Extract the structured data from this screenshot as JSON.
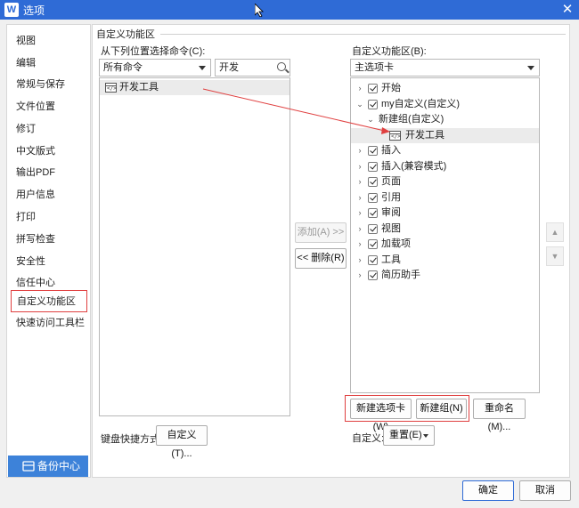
{
  "window": {
    "app_icon": "W",
    "title": "选项",
    "close_glyph": "✕"
  },
  "nav": {
    "items": [
      "视图",
      "编辑",
      "常规与保存",
      "文件位置",
      "修订",
      "中文版式",
      "输出PDF",
      "用户信息",
      "打印",
      "拼写检查",
      "安全性",
      "信任中心",
      "自定义功能区",
      "快速访问工具栏"
    ],
    "active_index": 12,
    "backup_label": "备份中心"
  },
  "main": {
    "section_title": "自定义功能区",
    "left": {
      "choose_label": "从下列位置选择命令(C):",
      "source_select": "所有命令",
      "search_value": "开发",
      "commands": [
        "开发工具"
      ]
    },
    "right": {
      "customize_label": "自定义功能区(B):",
      "tab_select": "主选项卡",
      "tree": [
        {
          "label": "开始",
          "level": 0,
          "expander": "›",
          "checkbox": true,
          "icon": false
        },
        {
          "label": "my自定义(自定义)",
          "level": 0,
          "expander": "⌄",
          "checkbox": true,
          "icon": false
        },
        {
          "label": "新建组(自定义)",
          "level": 1,
          "expander": "⌄",
          "checkbox": false,
          "icon": false
        },
        {
          "label": "开发工具",
          "level": 2,
          "expander": "",
          "checkbox": false,
          "icon": true,
          "selected": true
        },
        {
          "label": "插入",
          "level": 0,
          "expander": "›",
          "checkbox": true,
          "icon": false
        },
        {
          "label": "插入(兼容模式)",
          "level": 0,
          "expander": "›",
          "checkbox": true,
          "icon": false
        },
        {
          "label": "页面",
          "level": 0,
          "expander": "›",
          "checkbox": true,
          "icon": false
        },
        {
          "label": "引用",
          "level": 0,
          "expander": "›",
          "checkbox": true,
          "icon": false
        },
        {
          "label": "审阅",
          "level": 0,
          "expander": "›",
          "checkbox": true,
          "icon": false
        },
        {
          "label": "视图",
          "level": 0,
          "expander": "›",
          "checkbox": true,
          "icon": false
        },
        {
          "label": "加载项",
          "level": 0,
          "expander": "›",
          "checkbox": true,
          "icon": false
        },
        {
          "label": "工具",
          "level": 0,
          "expander": "›",
          "checkbox": true,
          "icon": false
        },
        {
          "label": "简历助手",
          "level": 0,
          "expander": "›",
          "checkbox": true,
          "icon": false
        }
      ],
      "new_tab_button": "新建选项卡(W)",
      "new_group_button": "新建组(N)",
      "rename_button": "重命名(M)...",
      "customize_label2": "自定义:",
      "reset_button": "重置(E)"
    },
    "add_button": "添加(A) >>",
    "remove_button": "<< 删除(R)",
    "move_up": "▲",
    "move_down": "▼",
    "keyboard_label": "键盘快捷方式:",
    "keyboard_button": "自定义(T)..."
  },
  "footer": {
    "ok": "确定",
    "cancel": "取消"
  },
  "colors": {
    "titlebar": "#2f6bd6",
    "highlight_red": "#e04040",
    "accent_blue": "#3d82d9"
  }
}
